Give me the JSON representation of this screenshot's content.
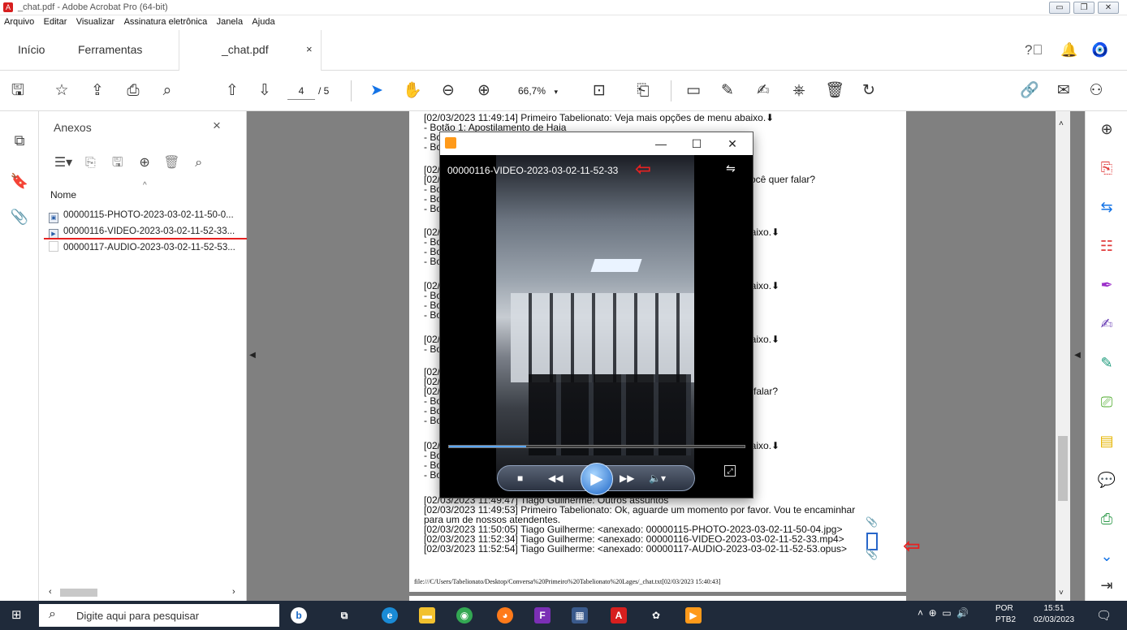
{
  "window": {
    "title": "_chat.pdf - Adobe Acrobat Pro (64-bit)",
    "app_glyph": "A"
  },
  "menu": [
    "Arquivo",
    "Editar",
    "Visualizar",
    "Assinatura eletrônica",
    "Janela",
    "Ajuda"
  ],
  "tabs": {
    "home": "Início",
    "tools": "Ferramentas",
    "doc": "_chat.pdf",
    "close": "×"
  },
  "toolbar": {
    "page_current": "4",
    "page_total": "/ 5",
    "zoom": "66,7%"
  },
  "panel": {
    "title": "Anexos",
    "close": "×",
    "column_header": "Nome",
    "sort_glyph": "^",
    "files": [
      {
        "name": "00000115-PHOTO-2023-03-02-11-50-0..."
      },
      {
        "name": "00000116-VIDEO-2023-03-02-11-52-33..."
      },
      {
        "name": "00000117-AUDIO-2023-03-02-11-52-53..."
      }
    ]
  },
  "document": {
    "lines": [
      "[02/03/2023 11:49:14] Primeiro Tabelionato: Veja mais opções de menu abaixo.⬇",
      "- Botão 1: Apostilamento de Haia",
      "[02/03/2023 11:49:47] Tiago Guilherme: Outros assuntos",
      "[02/03/2023 11:49:53] Primeiro Tabelionato: Ok, aguarde um momento por favor. Vou te encaminhar",
      "para um de nossos atendentes.",
      "[02/03/2023 11:50:05] Tiago Guilherme:  <anexado: 00000115-PHOTO-2023-03-02-11-50-04.jpg>",
      "[02/03/2023 11:52:34] Tiago Guilherme:  <anexado: 00000116-VIDEO-2023-03-02-11-52-33.mp4>",
      "[02/03/2023 11:52:54] Tiago Guilherme:  <anexado: 00000117-AUDIO-2023-03-02-11-52-53.opus>"
    ],
    "partial": [
      "- Bo",
      "- Bo",
      "[02/",
      "[02/",
      "- Bo",
      "- Bo",
      "- Bo",
      "[02/",
      "- Bo",
      "- Bo",
      "- Bo",
      "[02/",
      "- Bo",
      "- Bo",
      "- Bo",
      "[02/",
      "- Bo",
      "[02/",
      "[02/",
      "[02/",
      "- Bo",
      "- Bo",
      "- Bo",
      "[02/",
      "- Bo",
      "- Bo",
      "- Bo"
    ],
    "right_fragments": [
      "você quer falar?",
      "baixo.⬇",
      "baixo.⬇",
      "baixo.⬇",
      "e falar?",
      "baixo.⬇"
    ],
    "footer": "file:///C/Users/Tabelionato/Desktop/Conversa%20Primeiro%20Tabelionato%20Lages/_chat.txt[02/03/2023 15:40:43]"
  },
  "video": {
    "name": "00000116-VIDEO-2023-03-02-11-52-33",
    "progress": 0.26,
    "minimize": "—",
    "maximize": "☐",
    "close": "✕"
  },
  "taskbar": {
    "search_placeholder": "Digite aqui para pesquisar",
    "lang_top": "POR",
    "lang_bottom": "PTB2",
    "time": "15:51",
    "date": "02/03/2023"
  },
  "colors": {
    "accent": "#1473e6",
    "annotation_red": "#e62121",
    "taskbar": "#1f2a3a"
  }
}
